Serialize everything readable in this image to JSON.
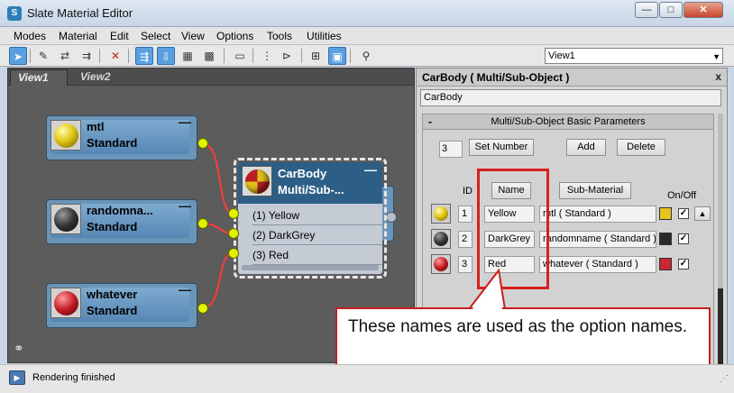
{
  "window": {
    "title": "Slate Material Editor",
    "app_icon_glyph": "S",
    "min_glyph": "—",
    "max_glyph": "□",
    "close_glyph": "✕"
  },
  "menu": [
    "Modes",
    "Material",
    "Edit",
    "Select",
    "View",
    "Options",
    "Tools",
    "Utilities"
  ],
  "toolbar": {
    "view_select_value": "View1",
    "dropdown_glyph": "▼"
  },
  "view_tabs": [
    "View1",
    "View2"
  ],
  "nodes": {
    "mtl": {
      "name": "mtl",
      "type": "Standard",
      "minus": "—"
    },
    "randomname": {
      "name": "randomna...",
      "type": "Standard",
      "minus": "—"
    },
    "whatever": {
      "name": "whatever",
      "type": "Standard",
      "minus": "—"
    },
    "multi": {
      "name": "CarBody",
      "type": "Multi/Sub-...",
      "minus": "—",
      "slots": [
        "(1) Yellow",
        "(2) DarkGrey",
        "(3) Red"
      ]
    }
  },
  "status": {
    "text": "Rendering finished",
    "icon_glyph": "▶"
  },
  "panel": {
    "title": "CarBody  ( Multi/Sub-Object )",
    "close_glyph": "x",
    "material_name": "CarBody",
    "rollout_minus": "-",
    "rollout_title": "Multi/Sub-Object Basic Parameters",
    "count": "3",
    "set_number_label": "Set Number",
    "add_label": "Add",
    "delete_label": "Delete",
    "columns": {
      "id": "ID",
      "name": "Name",
      "sub_material": "Sub-Material",
      "on_off": "On/Off"
    },
    "rows": [
      {
        "id": "1",
        "name": "Yellow",
        "sub_material": "mtl  ( Standard )",
        "color": "#e8c21e",
        "enabled": true
      },
      {
        "id": "2",
        "name": "DarkGrey",
        "sub_material": "randomname  ( Standard )",
        "color": "#2a2a2a",
        "enabled": true
      },
      {
        "id": "3",
        "name": "Red",
        "sub_material": "whatever  ( Standard )",
        "color": "#c8282e",
        "enabled": true
      }
    ],
    "check_glyph": "✓",
    "scroll_up_glyph": "▲"
  },
  "callout": {
    "text": "These names are used as the option names."
  }
}
